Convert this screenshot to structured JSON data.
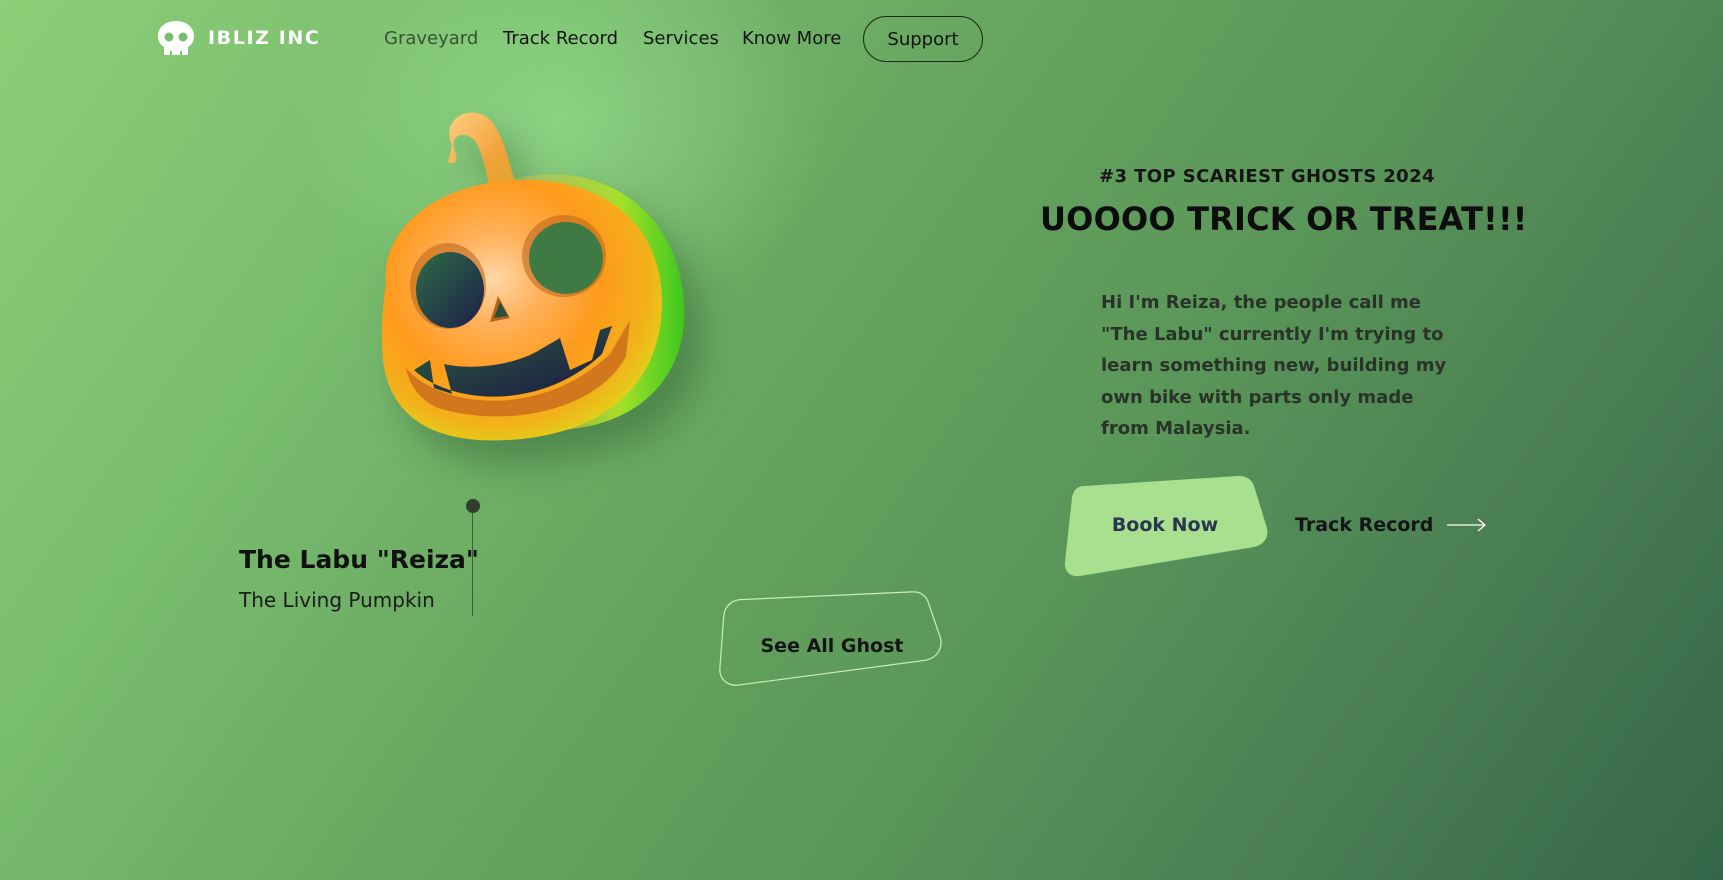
{
  "brand": {
    "name": "IBLIZ INC",
    "logo_icon": "skull-icon"
  },
  "nav": {
    "items": [
      {
        "label": "Graveyard"
      },
      {
        "label": "Track Record"
      },
      {
        "label": "Services"
      },
      {
        "label": "Know More"
      }
    ],
    "support_label": "Support"
  },
  "hero": {
    "eyebrow": "#3 TOP SCARIEST GHOSTS 2024",
    "headline": "UOOOO TRICK OR TREAT!!!",
    "bio": "Hi I'm Reiza, the people call me \"The Labu\" currently I'm trying to learn something new, building my own bike with parts only made from Malaysia.",
    "book_label": "Book Now",
    "track_label": "Track Record",
    "track_icon": "arrow-right-icon"
  },
  "ghost": {
    "name": "The Labu \"Reiza\"",
    "subtitle": "The Living Pumpkin",
    "image_icon": "pumpkin-icon"
  },
  "see_all_label": "See All Ghost",
  "colors": {
    "button_fill": "#a8e08f",
    "brand_text": "#ffffff"
  }
}
